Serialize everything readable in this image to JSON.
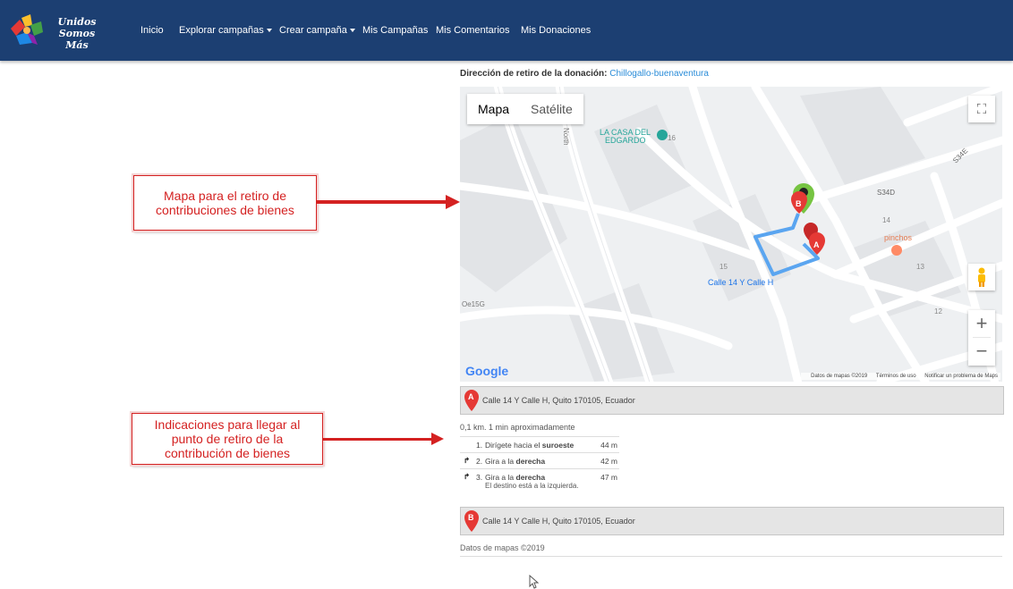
{
  "navbar": {
    "brand_line1": "Unidos",
    "brand_line2": "Somos Más",
    "items": [
      {
        "label": "Inicio",
        "dropdown": false
      },
      {
        "label": "Explorar campañas",
        "dropdown": true
      },
      {
        "label": "Crear campaña",
        "dropdown": true
      },
      {
        "label": "Mis Campañas",
        "dropdown": false
      },
      {
        "label": "Mis Comentarios",
        "dropdown": false
      },
      {
        "label": "Mis Donaciones",
        "dropdown": false
      }
    ],
    "bg_color": "#1c3f72"
  },
  "annotations": {
    "map_note": "Mapa para el retiro de contribuciones de bienes",
    "directions_note": "Indicaciones para llegar al punto de retiro de la contribución de bienes",
    "color": "#d42121"
  },
  "retiro": {
    "label": "Dirección de retiro de la donación:",
    "value": "Chillogallo-buenaventura"
  },
  "map": {
    "type_map": "Mapa",
    "type_satellite": "Satélite",
    "google": "Google",
    "data_credit": "Datos de mapas ©2019",
    "terms": "Términos de uso",
    "report": "Notificar un problema de Maps",
    "route_color": "#5aa5f0",
    "labels": {
      "poi1": "LA CASA DEL",
      "poi2": "EDGARDO",
      "pinchos": "pinchos",
      "s34d": "S34D",
      "s34e": "S34E",
      "calle": "Calle 14 Y Calle H",
      "oe15g": "Oe15G",
      "north": "North",
      "num14": "14",
      "num13": "13",
      "num12": "12",
      "num15": "15",
      "num16": "16",
      "marker_a": "A",
      "marker_b": "B"
    }
  },
  "directions": {
    "origin": {
      "marker": "A",
      "address": "Calle 14 Y Calle H, Quito 170105, Ecuador"
    },
    "summary": "0,1 km. 1 min aproximadamente",
    "steps": [
      {
        "num": "1.",
        "text_pre": "Dirígete hacia el ",
        "text_bold": "suroeste",
        "distance": "44 m",
        "icon": "",
        "note": ""
      },
      {
        "num": "2.",
        "text_pre": "Gira a la ",
        "text_bold": "derecha",
        "distance": "42 m",
        "icon": "turn-right-icon",
        "note": ""
      },
      {
        "num": "3.",
        "text_pre": "Gira a la ",
        "text_bold": "derecha",
        "distance": "47 m",
        "icon": "turn-right-icon",
        "note": "El destino está a la izquierda."
      }
    ],
    "destination": {
      "marker": "B",
      "address": "Calle 14 Y Calle H, Quito 170105, Ecuador"
    },
    "copyright": "Datos de mapas ©2019"
  }
}
